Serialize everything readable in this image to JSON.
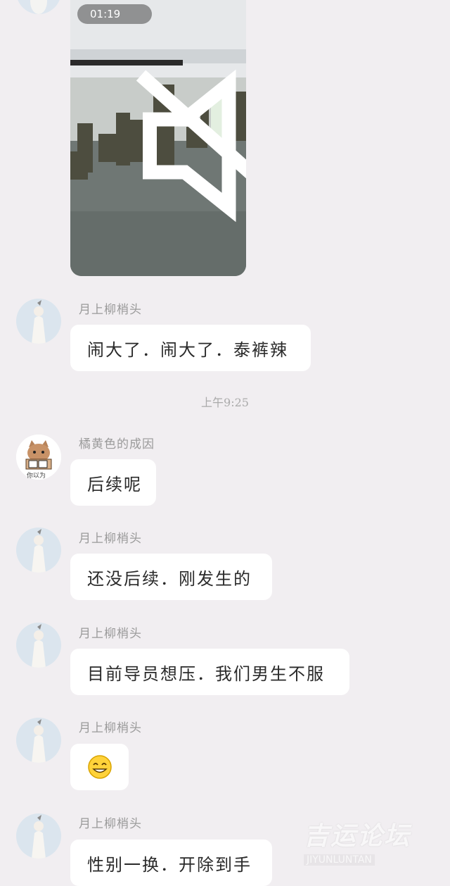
{
  "video": {
    "duration": "01:19",
    "mute_icon": "mute-icon"
  },
  "messages": [
    {
      "sender": "月上柳梢头",
      "text": "闹大了．闹大了．泰裤辣"
    },
    {
      "sender": "橘黄色的成因",
      "text": "后续呢"
    },
    {
      "sender": "月上柳梢头",
      "text": "还没后续．刚发生的"
    },
    {
      "sender": "月上柳梢头",
      "text": "目前导员想压．我们男生不服"
    },
    {
      "sender": "月上柳梢头",
      "emoji": "grinning-emoji"
    },
    {
      "sender": "月上柳梢头",
      "text": "性别一换．开除到手"
    }
  ],
  "timestamp": "上午9:25",
  "avatar_cat_label": "你以为",
  "watermark": {
    "line1": "吉运论坛",
    "line2": "JIYUNLUNTAN"
  },
  "colors": {
    "background": "#f1eef1",
    "bubble": "#ffffff",
    "name": "#9a9a9a",
    "text": "#2a2a2a"
  }
}
